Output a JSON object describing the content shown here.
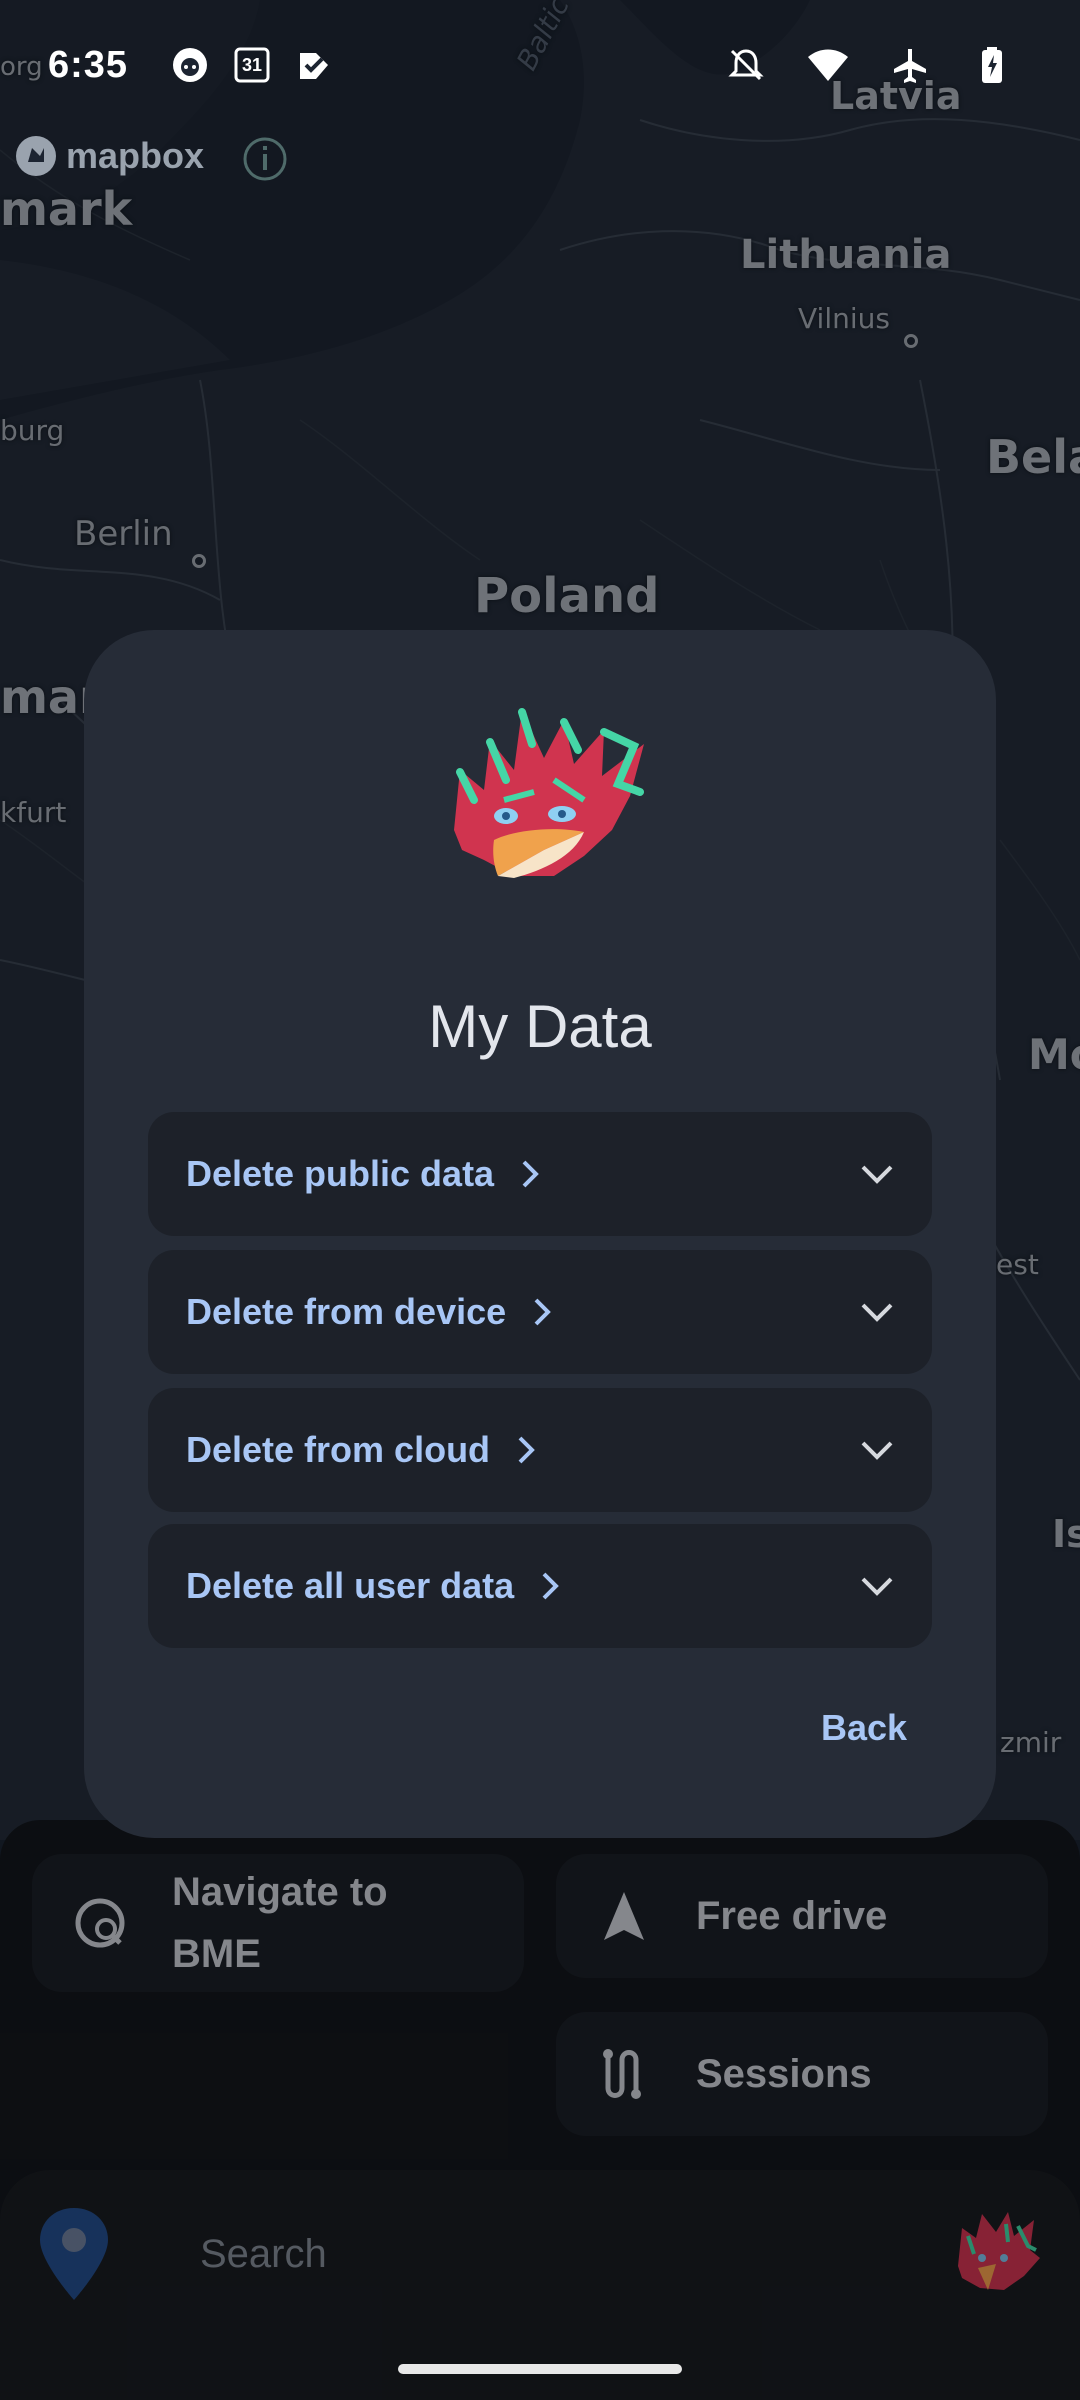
{
  "status_bar": {
    "time": "6:35",
    "left_icons": [
      "github-icon",
      "calendar-icon",
      "assistant-icon"
    ],
    "calendar_day": "31",
    "right_icons": [
      "notifications-off-icon",
      "wifi-icon",
      "airplane-mode-icon",
      "battery-charging-icon"
    ]
  },
  "map": {
    "attribution": "mapbox",
    "countries": [
      "Latvia",
      "Lithuania",
      "Poland",
      "Bela",
      "mark",
      "man",
      "Mo",
      "Is"
    ],
    "cities": [
      "Vilnius",
      "Berlin",
      "burg",
      "kfurt",
      "est",
      "zmir",
      "org"
    ],
    "water": [
      "Baltic Sea"
    ]
  },
  "dialog": {
    "title": "My Data",
    "items": [
      {
        "label": "Delete public data"
      },
      {
        "label": "Delete from device"
      },
      {
        "label": "Delete from cloud"
      },
      {
        "label": "Delete all user data"
      }
    ],
    "back_label": "Back"
  },
  "actions": {
    "navigate_label_line1": "Navigate to",
    "navigate_label_line2": "BME",
    "free_drive_label": "Free drive",
    "sessions_label": "Sessions"
  },
  "search": {
    "placeholder": "Search"
  },
  "colors": {
    "accent": "#a8c6f5",
    "dialog_bg": "#262c37",
    "item_bg": "#1d2129"
  }
}
